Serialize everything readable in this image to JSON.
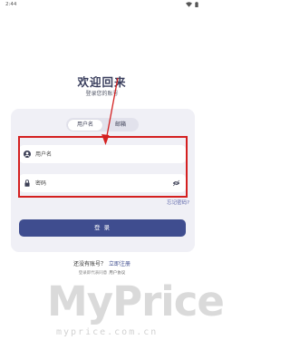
{
  "status_bar": {
    "time": "2:44",
    "icons": [
      "wifi-icon",
      "battery-icon"
    ]
  },
  "header": {
    "title": "欢迎回来",
    "subtitle": "登录您的账号"
  },
  "tabs": [
    {
      "label": "用户名",
      "selected": true
    },
    {
      "label": "邮箱",
      "selected": false
    }
  ],
  "form": {
    "username": {
      "placeholder": "用户名",
      "value": "",
      "icon": "user-icon"
    },
    "password": {
      "placeholder": "密码",
      "value": "",
      "icon": "lock-icon",
      "visibility_icon": "visibility-off-icon"
    },
    "forgot_password": "忘记密码?",
    "login_button": "登 录"
  },
  "footer": {
    "no_account": "还没有账号？",
    "register": "立即注册",
    "agreement_prefix": "登录即代表同意",
    "agreement_link": "用户协议"
  },
  "watermark": {
    "logo": "MyPrice",
    "url": "myprice.com.cn"
  },
  "colors": {
    "primary": "#3f4d8f",
    "card": "#f0f0f6",
    "annotation": "#d42020"
  }
}
